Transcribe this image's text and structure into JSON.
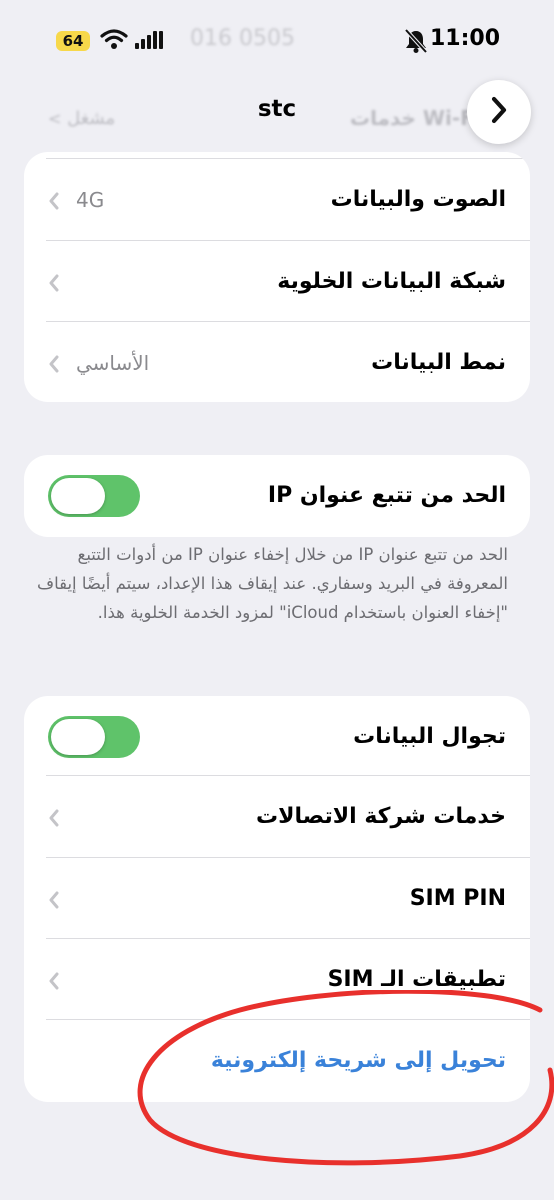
{
  "status_bar": {
    "battery_level": "64",
    "time": "11:00",
    "ghost_number": "016 0505"
  },
  "nav": {
    "title": "stc",
    "ghost_left_label": "مشغل",
    "ghost_right_label": "خدمات Wi-Fi"
  },
  "card1": {
    "rows": [
      {
        "label": "الصوت والبيانات",
        "value": "4G"
      },
      {
        "label": "شبكة البيانات الخلوية",
        "value": ""
      },
      {
        "label": "نمط البيانات",
        "value": "الأساسي"
      }
    ]
  },
  "ip_tracking": {
    "label": "الحد من تتبع عنوان IP",
    "enabled": true,
    "footnote": "الحد من تتبع عنوان IP من خلال إخفاء عنوان IP من أدوات التتبع المعروفة في البريد وسفاري. عند إيقاف هذا الإعداد، سيتم أيضًا إيقاف \"إخفاء العنوان باستخدام iCloud\" لمزود الخدمة الخلوية هذا."
  },
  "card3": {
    "roaming": {
      "label": "تجوال البيانات",
      "enabled": true
    },
    "rows": [
      {
        "label": "خدمات شركة الاتصالات"
      },
      {
        "label": "SIM PIN"
      },
      {
        "label": "تطبيقات الـ SIM"
      }
    ],
    "convert_link": "تحويل إلى شريحة إلكترونية"
  },
  "colors": {
    "toggle_on": "#5fc36a",
    "link": "#3a82d9",
    "annotation": "#e8302c"
  }
}
